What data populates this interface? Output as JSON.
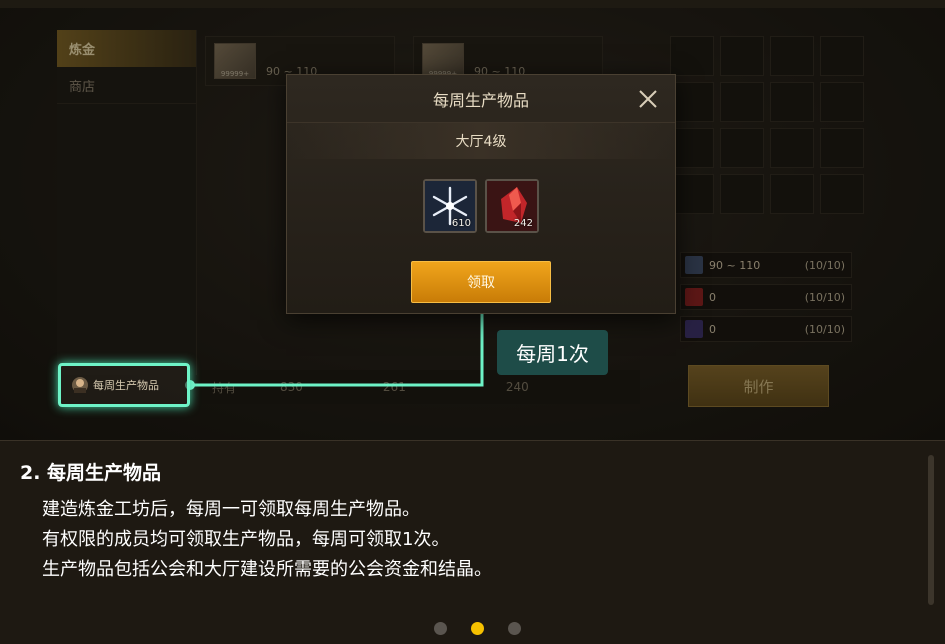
{
  "left_nav": {
    "items": [
      {
        "label": "炼金"
      },
      {
        "label": "商店"
      }
    ]
  },
  "background_cards": [
    {
      "thumb_text": "99999+",
      "range": "90 ~ 110"
    },
    {
      "thumb_text": "99999+",
      "range": "90 ~ 110"
    }
  ],
  "resources": [
    {
      "value": "90 ~ 110",
      "count": "(10/10)"
    },
    {
      "value": "0",
      "count": "(10/10)"
    },
    {
      "value": "0",
      "count": "(10/10)"
    }
  ],
  "hold_bar": {
    "label": "持有",
    "values": [
      "830",
      "261",
      "240"
    ]
  },
  "make_button": "制作",
  "modal": {
    "title": "每周生产物品",
    "subtitle": "大厅4级",
    "rewards": [
      {
        "icon": "snowflake-crystal-icon",
        "qty": "610"
      },
      {
        "icon": "red-gem-icon",
        "qty": "242"
      }
    ],
    "claim_button": "领取"
  },
  "weekly_button": {
    "label": "每周生产物品"
  },
  "callout": {
    "text": "每周1次"
  },
  "caption": {
    "heading": "2. 每周生产物品",
    "lines": [
      "建造炼金工坊后，每周一可领取每周生产物品。",
      "有权限的成员均可领取生产物品，每周可领取1次。",
      "生产物品包括公会和大厅建设所需要的公会资金和结晶。"
    ]
  },
  "pagination": {
    "total": 3,
    "active": 1
  },
  "colors": {
    "accent": "#f0a51c",
    "highlight": "#6ef3c7",
    "callout_bg": "#1e4c48",
    "dot_active": "#f6c100"
  }
}
